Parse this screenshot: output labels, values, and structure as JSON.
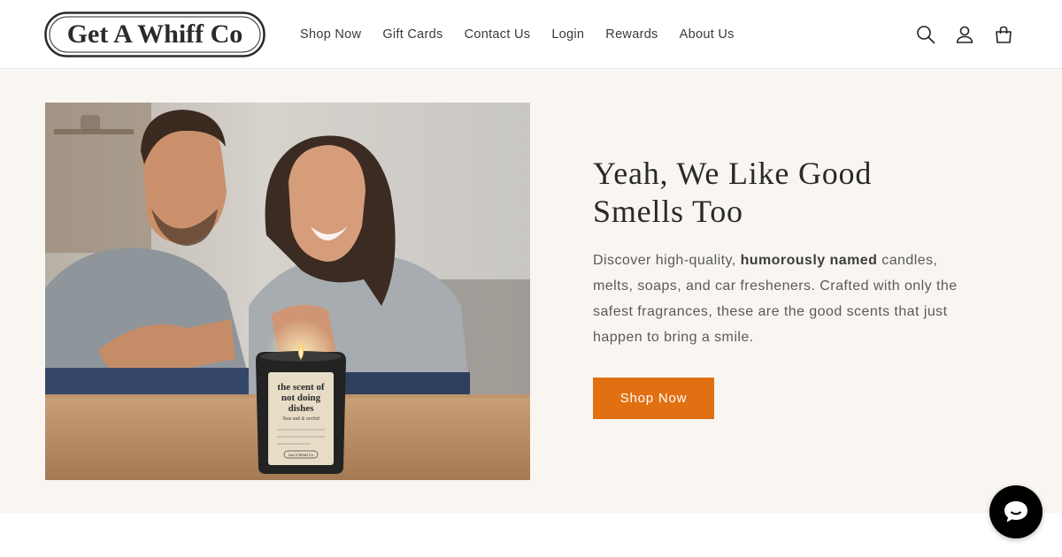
{
  "brand": {
    "logo_text": "Get A Whiff Co"
  },
  "nav": {
    "items": [
      {
        "label": "Shop Now"
      },
      {
        "label": "Gift Cards"
      },
      {
        "label": "Contact Us"
      },
      {
        "label": "Login"
      },
      {
        "label": "Rewards"
      },
      {
        "label": "About Us"
      }
    ]
  },
  "header_icons": [
    "search-icon",
    "account-icon",
    "cart-icon"
  ],
  "hero": {
    "title": "Yeah, We Like Good Smells Too",
    "text_before": "Discover high-quality, ",
    "text_bold": "humorously named",
    "text_after": " candles, melts, soaps, and car fresheners. Crafted with only the safest fragrances, these are the good scents that just happen to bring a smile.",
    "button_label": "Shop Now",
    "image": {
      "candle_label_line1": "the scent of",
      "candle_label_line2": "not doing",
      "candle_label_line3": "dishes",
      "candle_label_sub": "Sea salt & orchid",
      "candle_label_brand": "Get A Whiff Co"
    }
  },
  "colors": {
    "accent": "#e07012",
    "hero_bg": "#f9f6f2",
    "chat_bg": "#000000"
  },
  "chat_widget": {
    "icon": "chat-icon"
  }
}
